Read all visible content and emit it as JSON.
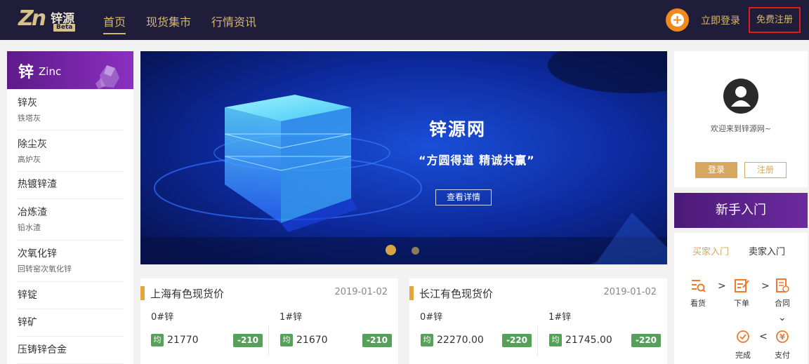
{
  "header": {
    "logo": {
      "mark": "Zn",
      "name": "锌源",
      "badge": "Beta"
    },
    "nav": [
      {
        "label": "首页",
        "active": true
      },
      {
        "label": "现货集市",
        "active": false
      },
      {
        "label": "行情资讯",
        "active": false
      }
    ],
    "login_label": "立即登录",
    "register_label": "免费注册"
  },
  "categories": {
    "header_cn": "锌",
    "header_en": "Zinc",
    "items": [
      {
        "title": "锌灰",
        "subtitle": "铁塔灰"
      },
      {
        "title": "除尘灰",
        "subtitle": "高炉灰"
      },
      {
        "title": "热镀锌渣",
        "subtitle": ""
      },
      {
        "title": "冶炼渣",
        "subtitle": "铅水渣"
      },
      {
        "title": "次氧化锌",
        "subtitle": "回转窑次氧化锌"
      },
      {
        "title": "锌锭",
        "subtitle": ""
      },
      {
        "title": "锌矿",
        "subtitle": ""
      },
      {
        "title": "压铸锌合金",
        "subtitle": ""
      }
    ]
  },
  "banner": {
    "title": "锌源网",
    "slogan": "“方圆得道 精诚共赢”",
    "button_label": "查看详情",
    "active_slide": 1,
    "slides": 2
  },
  "prices": [
    {
      "title": "上海有色现货价",
      "date": "2019-01-02",
      "items": [
        {
          "grade": "0#锌",
          "avg_label": "均",
          "value": "21770",
          "change": "-210"
        },
        {
          "grade": "1#锌",
          "avg_label": "均",
          "value": "21670",
          "change": "-210"
        }
      ]
    },
    {
      "title": "长江有色现货价",
      "date": "2019-01-02",
      "items": [
        {
          "grade": "0#锌",
          "avg_label": "均",
          "value": "22270.00",
          "change": "-220"
        },
        {
          "grade": "1#锌",
          "avg_label": "均",
          "value": "21745.00",
          "change": "-220"
        }
      ]
    }
  ],
  "user": {
    "welcome": "欢迎来到锌源网~",
    "login_label": "登录",
    "register_label": "注册"
  },
  "newbie": {
    "title": "新手入门",
    "tabs": [
      {
        "label": "买家入门",
        "active": true
      },
      {
        "label": "卖家入门",
        "active": false
      }
    ],
    "steps": [
      "看货",
      "下单",
      "合同",
      "完成",
      "支付"
    ]
  },
  "colors": {
    "header_bg": "#1f1d3a",
    "gold": "#d6b86a",
    "purple": "#6b2a9e",
    "green": "#57a05a",
    "orange": "#f08a1c",
    "highlight_red": "#e21c1c"
  }
}
